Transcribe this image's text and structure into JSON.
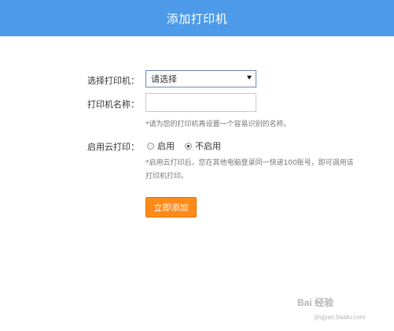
{
  "header": {
    "title": "添加打印机"
  },
  "form": {
    "printer_label": "选择打印机：",
    "printer_select_value": "请选择",
    "name_label": "打印机名称：",
    "name_value": "",
    "name_hint": "*请为您的打印机再设置一个容易识别的名称。",
    "cloud_label": "启用云打印：",
    "cloud_options": [
      {
        "label": "启用",
        "checked": false
      },
      {
        "label": "不启用",
        "checked": true
      }
    ],
    "cloud_hint": "*启用云打印后，您在其他电脑登录同一快递100账号，即可调用该打印机打印。",
    "add_button": "立即添加"
  },
  "watermark": {
    "text": "Bai 经验",
    "url": "jingyan.baidu.com"
  }
}
